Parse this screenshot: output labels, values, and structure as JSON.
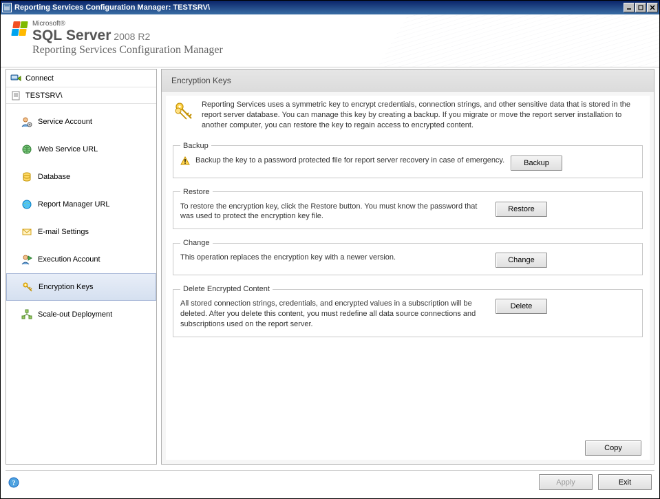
{
  "window": {
    "title": "Reporting Services Configuration Manager: TESTSRV\\"
  },
  "branding": {
    "microsoft": "Microsoft®",
    "product_bold1": "SQL",
    "product_bold2": "Server",
    "year": "2008 R2",
    "subtitle": "Reporting Services Configuration Manager"
  },
  "sidebar": {
    "connect": "Connect",
    "server": "TESTSRV\\",
    "items": [
      {
        "label": "Service Account"
      },
      {
        "label": "Web Service URL"
      },
      {
        "label": "Database"
      },
      {
        "label": "Report Manager URL"
      },
      {
        "label": "E-mail Settings"
      },
      {
        "label": "Execution Account"
      },
      {
        "label": "Encryption Keys"
      },
      {
        "label": "Scale-out Deployment"
      }
    ]
  },
  "panel": {
    "title": "Encryption Keys",
    "intro": "Reporting Services uses a symmetric key to encrypt credentials, connection strings, and other sensitive data that is stored in the report server database.  You can manage this key by creating a backup.  If you migrate or move the report server installation to another computer, you can restore the key to regain access to encrypted content.",
    "groups": {
      "backup": {
        "legend": "Backup",
        "text": "Backup the key to a password protected file for report server recovery in case of emergency.",
        "button": "Backup"
      },
      "restore": {
        "legend": "Restore",
        "text": "To restore the encryption key, click the Restore button.  You must know the password that was used to protect the encryption key file.",
        "button": "Restore"
      },
      "change": {
        "legend": "Change",
        "text": "This operation replaces the encryption key with a newer version.",
        "button": "Change"
      },
      "delete": {
        "legend": "Delete Encrypted Content",
        "text": "All stored connection strings, credentials, and encrypted values in a subscription will be deleted.  After you delete this content, you must redefine all data source connections and subscriptions used on the report server.",
        "button": "Delete"
      }
    },
    "copy_button": "Copy"
  },
  "footer": {
    "apply": "Apply",
    "exit": "Exit"
  }
}
